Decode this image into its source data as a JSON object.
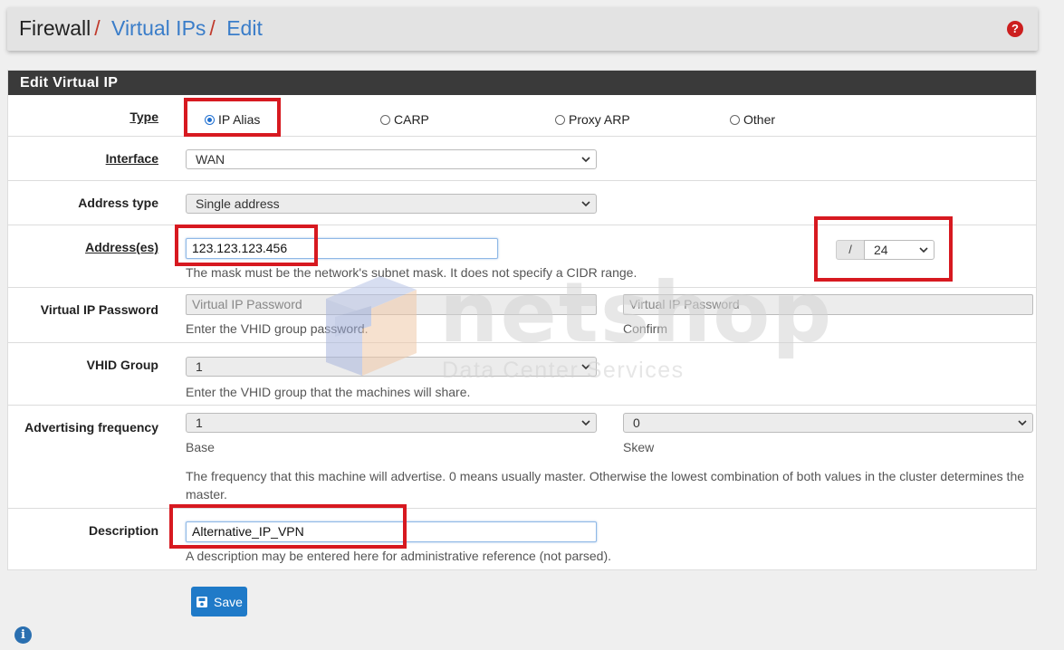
{
  "breadcrumb": {
    "root": "Firewall",
    "sep1": "/",
    "mid": "Virtual IPs",
    "sep2": "/",
    "current": "Edit"
  },
  "help_icon": "question-circle-icon",
  "panel": {
    "title": "Edit Virtual IP"
  },
  "type": {
    "label": "Type",
    "options": [
      "IP Alias",
      "CARP",
      "Proxy ARP",
      "Other"
    ],
    "selected": "IP Alias"
  },
  "interface": {
    "label": "Interface",
    "value": "WAN"
  },
  "address_type": {
    "label": "Address type",
    "value": "Single address"
  },
  "address": {
    "label": "Address(es)",
    "value": "123.123.123.456",
    "slash": "/",
    "cidr": "24",
    "help": "The mask must be the network's subnet mask. It does not specify a CIDR range."
  },
  "vip_password": {
    "label": "Virtual IP Password",
    "placeholder": "Virtual IP Password",
    "help": "Enter the VHID group password.",
    "confirm_placeholder": "Virtual IP Password",
    "confirm_label": "Confirm"
  },
  "vhid": {
    "label": "VHID Group",
    "value": "1",
    "help": "Enter the VHID group that the machines will share."
  },
  "advertising": {
    "label": "Advertising frequency",
    "base_value": "1",
    "base_label": "Base",
    "skew_value": "0",
    "skew_label": "Skew",
    "help": "The frequency that this machine will advertise. 0 means usually master. Otherwise the lowest combination of both values in the cluster determines the master."
  },
  "description": {
    "label": "Description",
    "value": "Alternative_IP_VPN",
    "help": "A description may be entered here for administrative reference (not parsed)."
  },
  "save_button": {
    "label": "Save",
    "icon": "save-icon"
  },
  "info_icon": "info-icon",
  "watermark": {
    "name": "netshop",
    "tagline": "Data Center Services"
  },
  "colors": {
    "accent": "#1f7ac8",
    "highlight": "#d71920",
    "panel_header": "#3a3a3a"
  }
}
